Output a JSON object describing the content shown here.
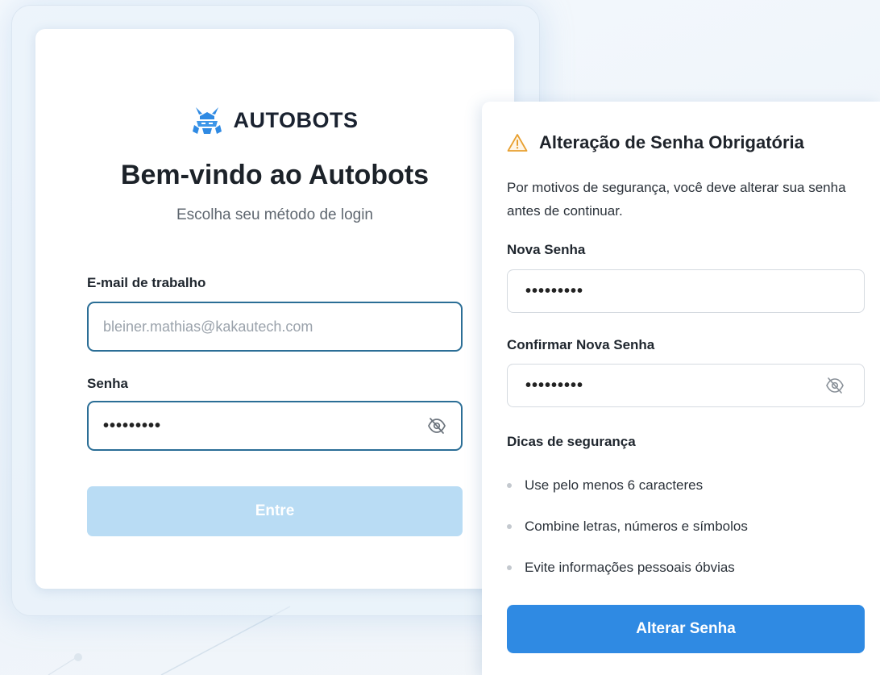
{
  "login": {
    "brand_name": "AUTOBOTS",
    "title": "Bem-vindo ao Autobots",
    "subtitle": "Escolha seu método de login",
    "email_label": "E-mail de trabalho",
    "email_placeholder": "bleiner.mathias@kakautech.com",
    "password_label": "Senha",
    "password_value": "•••••••••",
    "submit_label": "Entre"
  },
  "password_change": {
    "title": "Alteração de Senha Obrigatória",
    "description": "Por motivos de segurança, você deve alterar sua senha antes de continuar.",
    "new_password_label": "Nova Senha",
    "new_password_value": "•••••••••",
    "confirm_password_label": "Confirmar Nova Senha",
    "confirm_password_value": "•••••••••",
    "tips_title": "Dicas de segurança",
    "tips": [
      "Use pelo menos 6 caracteres",
      "Combine letras, números e símbolos",
      "Evite informações pessoais óbvias"
    ],
    "submit_label": "Alterar Senha"
  },
  "icons": {
    "brand": "autobots-logo-icon",
    "warning": "warning-triangle-icon",
    "visibility": "eye-off-icon"
  },
  "colors": {
    "primary": "#2f8ae3",
    "disabled_button": "#b9dcf4",
    "input_focus_border": "#2b6e96",
    "warning": "#e8a030"
  }
}
